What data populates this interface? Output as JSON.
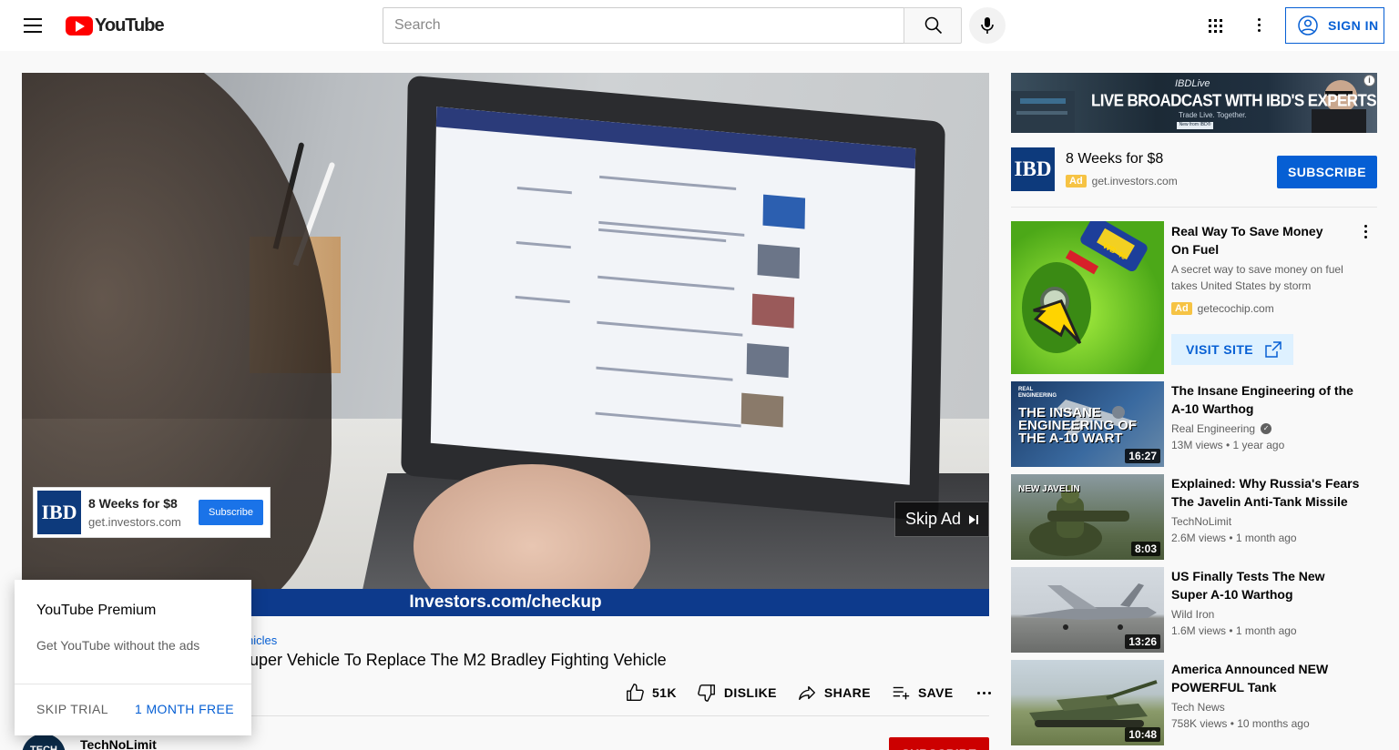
{
  "header": {
    "logo_text": "YouTube",
    "search_placeholder": "Search",
    "sign_in_label": "SIGN IN"
  },
  "player": {
    "url_band_text": "Investors.com/checkup",
    "overlay_ad": {
      "logo_text": "IBD",
      "headline": "8 Weeks for $8",
      "domain": "get.investors.com",
      "cta": "Subscribe"
    },
    "skip_label": "Skip Ad"
  },
  "video": {
    "hashtags_partial": "hicles",
    "title_partial": "uper Vehicle To Replace The M2 Bradley Fighting Vehicle",
    "actions": {
      "like_count": "51K",
      "dislike_label": "DISLIKE",
      "share_label": "SHARE",
      "save_label": "SAVE"
    },
    "owner": {
      "avatar_text": "TECH",
      "name": "TechNoLimit",
      "subscribe_label": "SUBSCRIBE"
    }
  },
  "premium_popup": {
    "title": "YouTube Premium",
    "description": "Get YouTube without the ads",
    "skip_label": "SKIP TRIAL",
    "free_label": "1 MONTH FREE"
  },
  "sidebar": {
    "banner_ad": {
      "brand": "IBDLive",
      "headline": "LIVE BROADCAST WITH IBD'S EXPERTS",
      "tagline": "Trade Live. Together.",
      "badge": "New from IBD®",
      "info_glyph": "i"
    },
    "companion_ad": {
      "logo_text": "IBD",
      "headline": "8 Weeks for $8",
      "ad_badge": "Ad",
      "domain": "get.investors.com",
      "cta": "SUBSCRIBE"
    },
    "promo": {
      "title": "Real Way To Save Money On Fuel",
      "description": "A secret way to save money on fuel takes United States by storm",
      "ad_badge": "Ad",
      "domain": "getecochip.com",
      "cta": "VISIT SITE",
      "thumb_label": "WD-40"
    },
    "recommendations": [
      {
        "title": "The Insane Engineering of the A-10 Warthog",
        "channel": "Real Engineering",
        "verified": true,
        "meta": "13M views • 1 year ago",
        "duration": "16:27",
        "thumb_top": "REAL ENGINEERING",
        "thumb_text": "THE INSANE ENGINEERING OF THE A-10 WART"
      },
      {
        "title": "Explained: Why Russia's Fears The Javelin Anti-Tank Missile",
        "channel": "TechNoLimit",
        "verified": false,
        "meta": "2.6M views • 1 month ago",
        "duration": "8:03",
        "thumb_text": "NEW JAVELIN"
      },
      {
        "title": "US Finally Tests The New Super A-10 Warthog",
        "channel": "Wild Iron",
        "verified": false,
        "meta": "1.6M views • 1 month ago",
        "duration": "13:26"
      },
      {
        "title": "America Announced NEW POWERFUL Tank",
        "channel": "Tech News",
        "verified": false,
        "meta": "758K views • 10 months ago",
        "duration": "10:48"
      }
    ]
  },
  "icons": [
    "menu-icon",
    "youtube-logo-icon",
    "search-icon",
    "mic-icon",
    "apps-icon",
    "more-vert-icon",
    "account-icon",
    "skip-icon",
    "like-icon",
    "dislike-icon",
    "share-icon",
    "save-icon",
    "more-horiz-icon",
    "info-icon",
    "open-external-icon",
    "verified-icon"
  ],
  "colors": {
    "brand_red": "#ff0000",
    "link_blue": "#065fd4",
    "ad_yellow": "#f6c344",
    "ibd_navy": "#0d3a7c",
    "subscribe_red": "#cc0000"
  }
}
